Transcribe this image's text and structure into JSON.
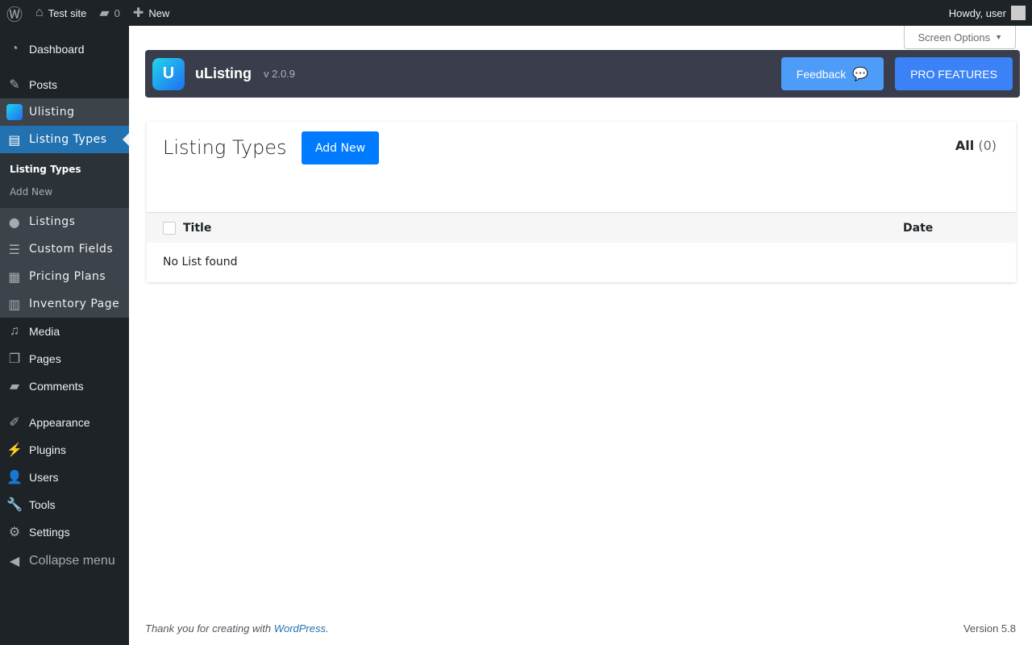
{
  "adminbar": {
    "site": "Test site",
    "comments": "0",
    "new": "New",
    "howdy": "Howdy, user"
  },
  "menu": {
    "dashboard": "Dashboard",
    "posts": "Posts",
    "ulisting": "Ulisting",
    "listing_types": "Listing Types",
    "sub": [
      "Listing Types",
      "Add New"
    ],
    "listings": "Listings",
    "custom_fields": "Custom Fields",
    "pricing_plans": "Pricing Plans",
    "inventory": "Inventory Page",
    "media": "Media",
    "pages": "Pages",
    "comments": "Comments",
    "appearance": "Appearance",
    "plugins": "Plugins",
    "users": "Users",
    "tools": "Tools",
    "settings": "Settings",
    "collapse": "Collapse menu"
  },
  "screen_options": "Screen Options",
  "header": {
    "brand": "uListing",
    "version": "v 2.0.9",
    "feedback": "Feedback",
    "pro": "PRO FEATURES"
  },
  "card": {
    "title": "Listing Types",
    "add_new": "Add New",
    "all_label": "All",
    "all_count": "(0)",
    "columns": [
      "Title",
      "Date"
    ],
    "empty": "No List found"
  },
  "footer": {
    "thanks": "Thank you for creating with ",
    "link": "WordPress",
    "period": ".",
    "version": "Version 5.8"
  }
}
